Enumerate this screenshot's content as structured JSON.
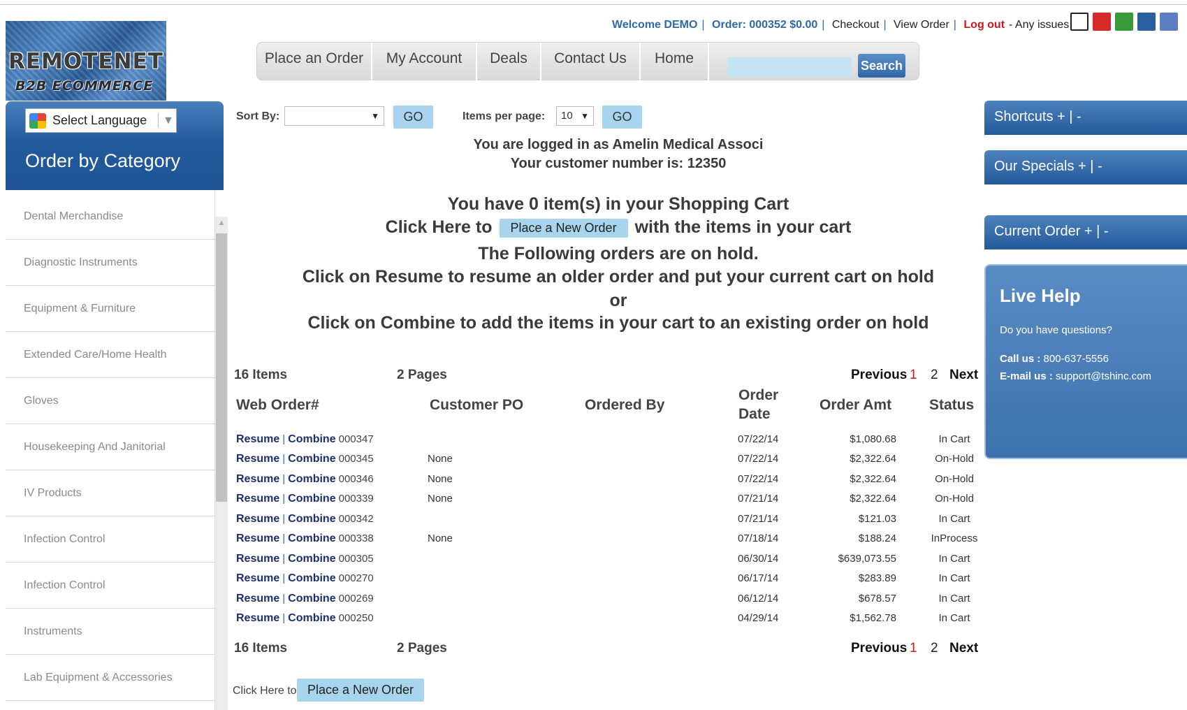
{
  "logo": {
    "line1": "REMOTENET",
    "line2": "B2B ECOMMERCE"
  },
  "welcome": {
    "user": "Welcome DEMO",
    "order": "Order: 000352 $0.00",
    "checkout": "Checkout",
    "view_order": "View Order",
    "logout": "Log out",
    "issues": "- Any issues ?"
  },
  "nav": {
    "items": [
      "Place an Order",
      "My Account",
      "Deals",
      "Contact Us",
      "Home"
    ],
    "search_placeholder": "",
    "search_button": "Search"
  },
  "sidebar": {
    "language": "Select Language",
    "title": "Order by Category",
    "categories": [
      "Dental Merchandise",
      "Diagnostic Instruments",
      "Equipment & Furniture",
      "Extended Care/Home Health",
      "Gloves",
      "Housekeeping And Janitorial",
      "IV Products",
      "Infection Control",
      "Infection Control",
      "Instruments",
      "Lab Equipment & Accessories"
    ]
  },
  "controls": {
    "sort_label": "Sort By:",
    "sort_value": "",
    "go": "GO",
    "per_page_label": "Items per page:",
    "per_page_value": "10"
  },
  "messages": {
    "logged_in": "You are logged in as Amelin Medical Associ",
    "customer_number": "Your customer number is: 12350",
    "cart": "You have 0 item(s) in your Shopping Cart",
    "click_here": "Click Here to",
    "place_new_order": "Place a New Order",
    "with_items": "with the items in your cart",
    "on_hold": "The Following orders are on hold.",
    "resume_info": "Click on Resume to resume an older order and put your current cart on hold",
    "or": "or",
    "combine_info": "Click on Combine to add the items in your cart to an existing order on hold"
  },
  "pager": {
    "items": "16 Items",
    "pages": "2 Pages",
    "previous": "Previous",
    "page1": "1",
    "page2": "2",
    "next": "Next"
  },
  "table": {
    "headers": {
      "web_order": "Web Order#",
      "customer_po": "Customer PO",
      "ordered_by": "Ordered By",
      "order_date_1": "Order",
      "order_date_2": "Date",
      "order_amt": "Order Amt",
      "status": "Status"
    },
    "resume": "Resume",
    "combine": "Combine",
    "rows": [
      {
        "num": "000347",
        "po": "",
        "date": "07/22/14",
        "amt": "$1,080.68",
        "status": "In Cart"
      },
      {
        "num": "000345",
        "po": "None",
        "date": "07/22/14",
        "amt": "$2,322.64",
        "status": "On-Hold"
      },
      {
        "num": "000346",
        "po": "None",
        "date": "07/22/14",
        "amt": "$2,322.64",
        "status": "On-Hold"
      },
      {
        "num": "000339",
        "po": "None",
        "date": "07/21/14",
        "amt": "$2,322.64",
        "status": "On-Hold"
      },
      {
        "num": "000342",
        "po": "",
        "date": "07/21/14",
        "amt": "$121.03",
        "status": "In Cart"
      },
      {
        "num": "000338",
        "po": "None",
        "date": "07/18/14",
        "amt": "$188.24",
        "status": "InProcess"
      },
      {
        "num": "000305",
        "po": "",
        "date": "06/30/14",
        "amt": "$639,073.55",
        "status": "In Cart"
      },
      {
        "num": "000270",
        "po": "",
        "date": "06/17/14",
        "amt": "$283.89",
        "status": "In Cart"
      },
      {
        "num": "000269",
        "po": "",
        "date": "06/12/14",
        "amt": "$678.57",
        "status": "In Cart"
      },
      {
        "num": "000250",
        "po": "",
        "date": "04/29/14",
        "amt": "$1,562.78",
        "status": "In Cart"
      }
    ]
  },
  "bottom": {
    "click_here": "Click Here to",
    "place_new_order": "Place a New Order"
  },
  "right": {
    "shortcuts": "Shortcuts + | -",
    "specials": "Our Specials + | -",
    "current_order": "Current Order + | -",
    "live_help": {
      "title": "Live Help",
      "question": "Do you have questions?",
      "call_label": "Call us :",
      "call_value": "800-637-5556",
      "mail_label": "E-mail us :",
      "mail_value": "support@tshinc.com"
    }
  },
  "icons": [
    "print-icon",
    "pdf-icon",
    "excel-icon",
    "image-icon",
    "word-icon"
  ]
}
